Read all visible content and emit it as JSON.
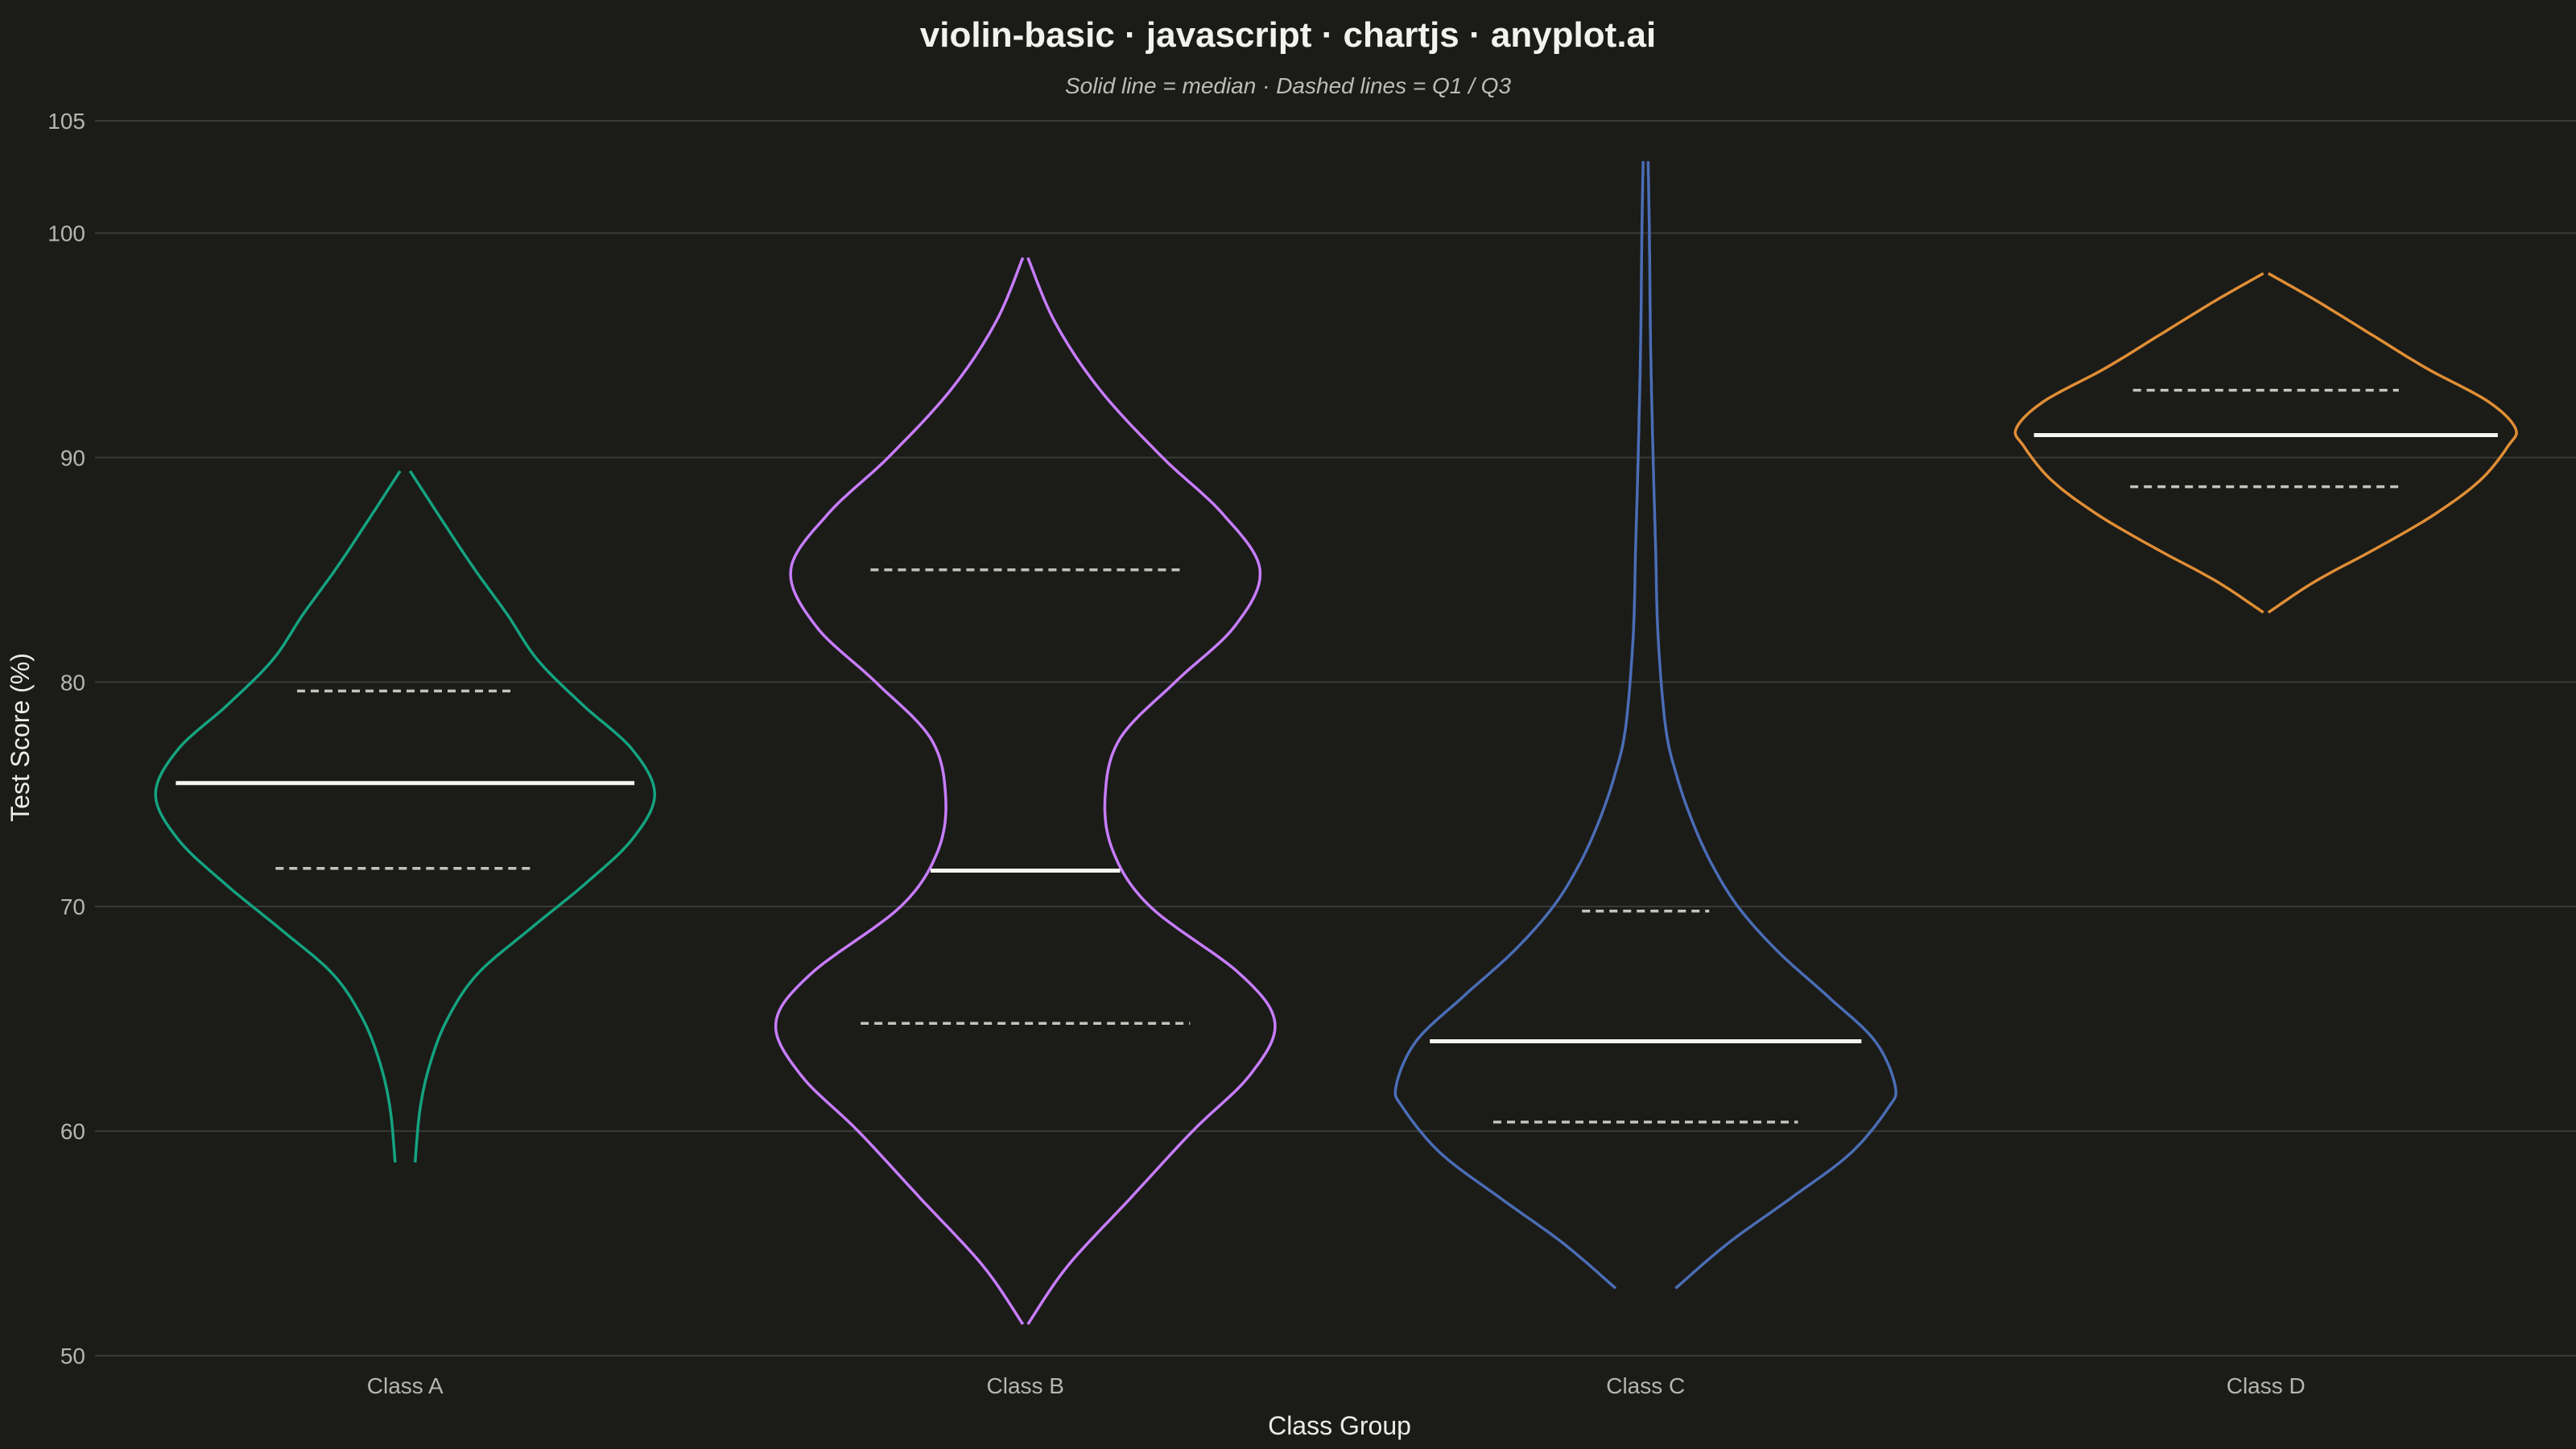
{
  "chart_data": {
    "type": "violin",
    "title": "violin-basic · javascript · chartjs · anyplot.ai",
    "subtitle": "Solid line = median · Dashed lines = Q1 / Q3",
    "xlabel": "Class Group",
    "ylabel": "Test Score (%)",
    "ylim": [
      50,
      105
    ],
    "yticks": [
      50,
      60,
      70,
      80,
      90,
      100,
      105
    ],
    "ytick_labels": [
      "50",
      "60",
      "70",
      "80",
      "90",
      "100",
      "105"
    ],
    "grid": true,
    "categories": [
      "Class A",
      "Class B",
      "Class C",
      "Class D"
    ],
    "series": [
      {
        "category": "Class A",
        "color": "#14a37f",
        "median": 75.5,
        "q1": 71.7,
        "q3": 79.6,
        "y_min": 58.6,
        "y_max": 89.4,
        "density_profile": [
          [
            58.6,
            0.04
          ],
          [
            61,
            0.06
          ],
          [
            63,
            0.1
          ],
          [
            65,
            0.17
          ],
          [
            67,
            0.29
          ],
          [
            69,
            0.5
          ],
          [
            71,
            0.72
          ],
          [
            73,
            0.91
          ],
          [
            75,
            1.0
          ],
          [
            77,
            0.91
          ],
          [
            79,
            0.71
          ],
          [
            81,
            0.53
          ],
          [
            83,
            0.41
          ],
          [
            85,
            0.28
          ],
          [
            87,
            0.16
          ],
          [
            89.4,
            0.02
          ]
        ]
      },
      {
        "category": "Class B",
        "color": "#c77dff",
        "median": 71.6,
        "q1": 64.8,
        "q3": 85.0,
        "y_min": 51.4,
        "y_max": 98.9,
        "density_profile": [
          [
            51.4,
            0.01
          ],
          [
            54,
            0.17
          ],
          [
            57,
            0.42
          ],
          [
            60,
            0.67
          ],
          [
            62.5,
            0.9
          ],
          [
            64.8,
            1.0
          ],
          [
            67,
            0.86
          ],
          [
            70,
            0.5
          ],
          [
            72.5,
            0.35
          ],
          [
            75,
            0.32
          ],
          [
            77.5,
            0.38
          ],
          [
            80,
            0.6
          ],
          [
            82.5,
            0.84
          ],
          [
            85,
            0.94
          ],
          [
            87.5,
            0.79
          ],
          [
            90,
            0.55
          ],
          [
            93,
            0.3
          ],
          [
            96,
            0.12
          ],
          [
            98.9,
            0.01
          ]
        ]
      },
      {
        "category": "Class C",
        "color": "#4a6db5",
        "median": 64.0,
        "q1": 60.4,
        "q3": 69.8,
        "y_min": 53.0,
        "y_max": 103.2,
        "density_profile": [
          [
            53,
            0.12
          ],
          [
            55,
            0.33
          ],
          [
            57,
            0.58
          ],
          [
            59,
            0.82
          ],
          [
            61,
            0.97
          ],
          [
            62,
            1.0
          ],
          [
            64,
            0.92
          ],
          [
            66,
            0.73
          ],
          [
            68,
            0.53
          ],
          [
            70,
            0.37
          ],
          [
            72,
            0.26
          ],
          [
            74,
            0.18
          ],
          [
            76,
            0.12
          ],
          [
            78,
            0.08
          ],
          [
            82,
            0.05
          ],
          [
            86,
            0.04
          ],
          [
            90,
            0.03
          ],
          [
            95,
            0.02
          ],
          [
            100,
            0.015
          ],
          [
            103.2,
            0.01
          ]
        ]
      },
      {
        "category": "Class D",
        "color": "#e08e35",
        "median": 91.0,
        "q1": 88.7,
        "q3": 93.0,
        "y_min": 83.1,
        "y_max": 98.2,
        "density_profile": [
          [
            83.1,
            0.01
          ],
          [
            84.5,
            0.2
          ],
          [
            86,
            0.45
          ],
          [
            87.5,
            0.68
          ],
          [
            89,
            0.86
          ],
          [
            90.5,
            0.97
          ],
          [
            91.3,
            1.0
          ],
          [
            92.5,
            0.89
          ],
          [
            94,
            0.64
          ],
          [
            95.5,
            0.42
          ],
          [
            97,
            0.2
          ],
          [
            98.2,
            0.01
          ]
        ]
      }
    ]
  }
}
